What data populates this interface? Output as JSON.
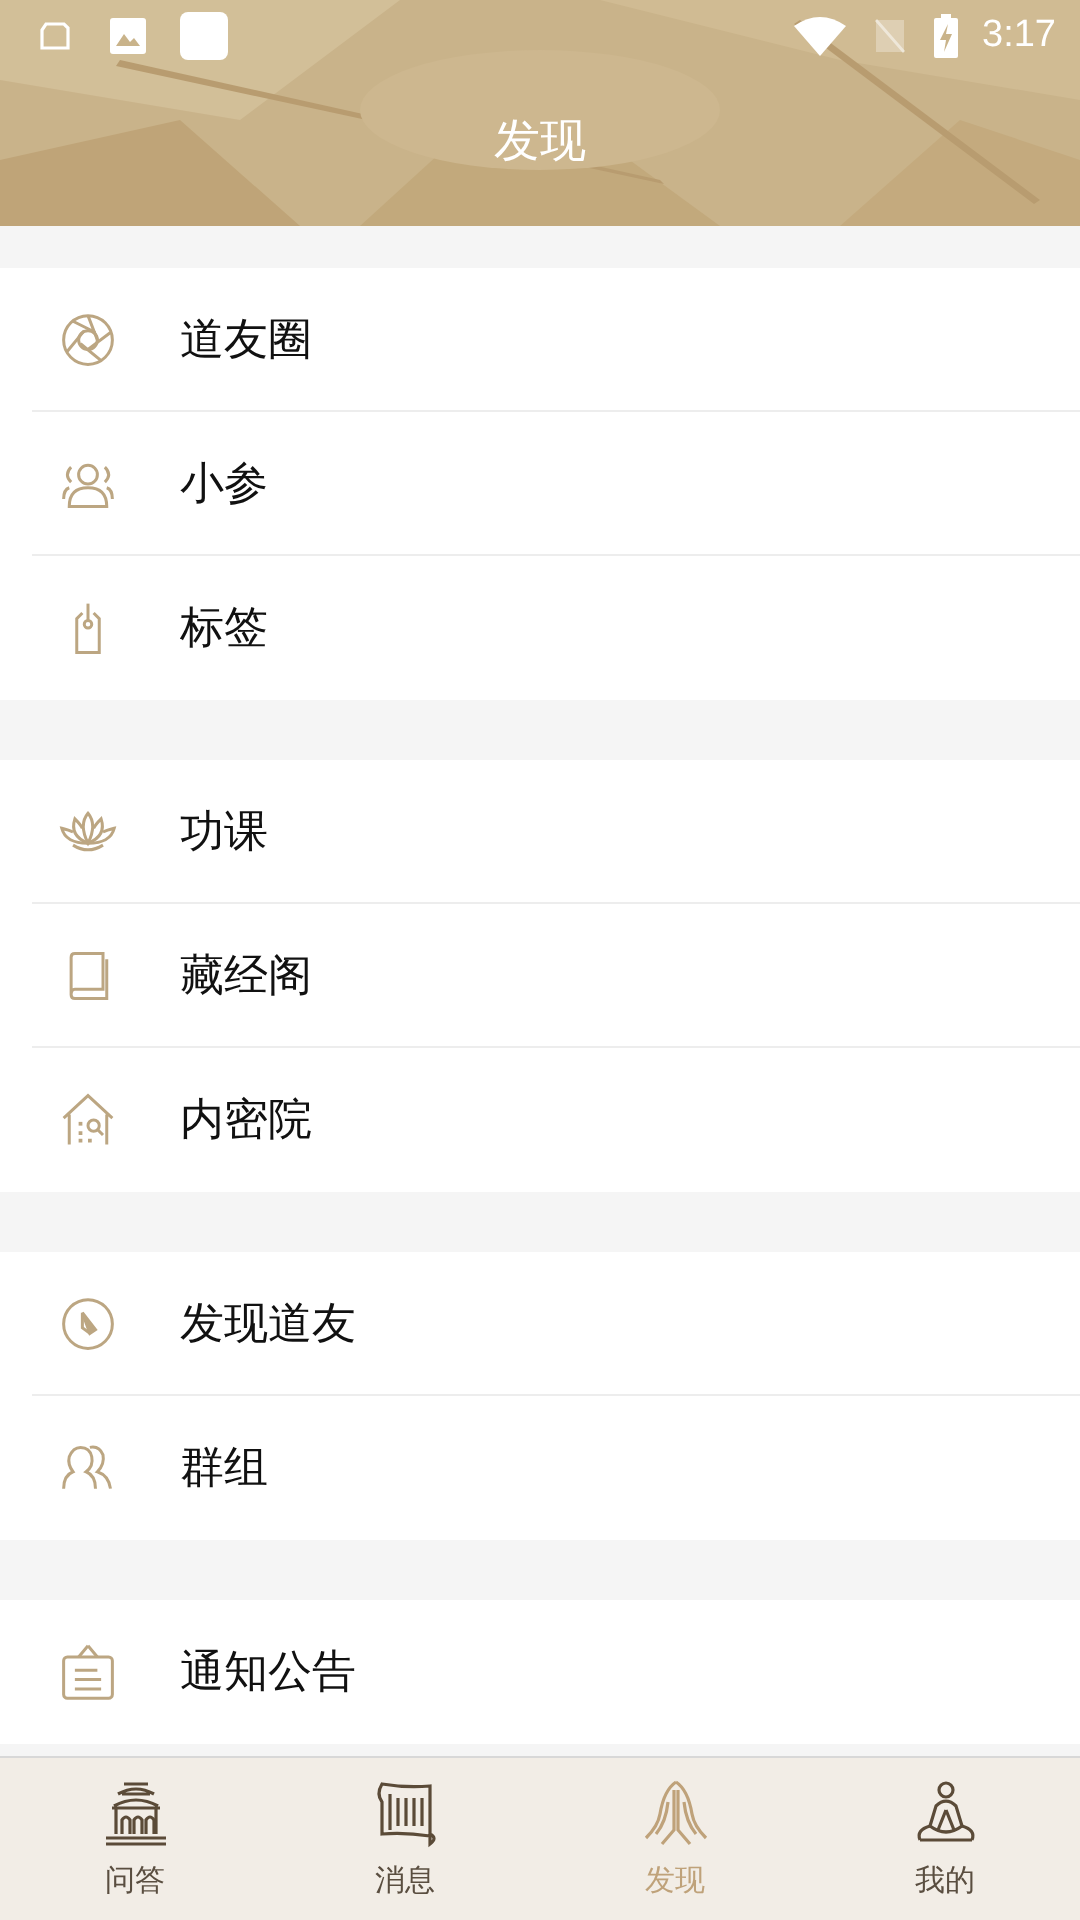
{
  "status_bar": {
    "time": "3:17"
  },
  "header": {
    "title": "发现"
  },
  "sections": [
    {
      "items": [
        {
          "label": "道友圈"
        },
        {
          "label": "小参"
        },
        {
          "label": "标签"
        }
      ]
    },
    {
      "items": [
        {
          "label": "功课"
        },
        {
          "label": "藏经阁"
        },
        {
          "label": "内密院"
        }
      ]
    },
    {
      "items": [
        {
          "label": "发现道友"
        },
        {
          "label": "群组"
        }
      ]
    },
    {
      "items": [
        {
          "label": "通知公告"
        }
      ]
    }
  ],
  "tabs": [
    {
      "label": "问答",
      "selected": false
    },
    {
      "label": "消息",
      "selected": false
    },
    {
      "label": "发现",
      "selected": true
    },
    {
      "label": "我的",
      "selected": false
    }
  ]
}
